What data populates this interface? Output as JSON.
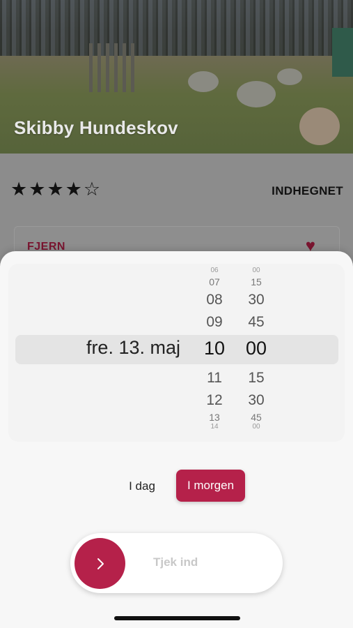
{
  "hero": {
    "title": "Skibby Hundeskov"
  },
  "details": {
    "rating": 4,
    "rating_max": 5,
    "stars": [
      "★",
      "★",
      "★",
      "★",
      "☆"
    ],
    "fence_type": "INDHEGNET",
    "remove_label": "FJERN",
    "favorite_icon": "heart-icon"
  },
  "picker": {
    "date_selected": "fre. 13. maj",
    "hours": [
      "07",
      "08",
      "09",
      "10",
      "11",
      "12",
      "13"
    ],
    "minutes": [
      "15",
      "30",
      "45",
      "00",
      "15",
      "30",
      "45"
    ],
    "hour_selected": "10",
    "minute_selected": "00"
  },
  "day_toggle": {
    "today": "I dag",
    "tomorrow": "I morgen",
    "selected": "tomorrow"
  },
  "slider": {
    "label": "Tjek ind",
    "icon": "chevron-right-icon"
  },
  "colors": {
    "accent": "#b5214a",
    "remove": "#7a1530"
  }
}
